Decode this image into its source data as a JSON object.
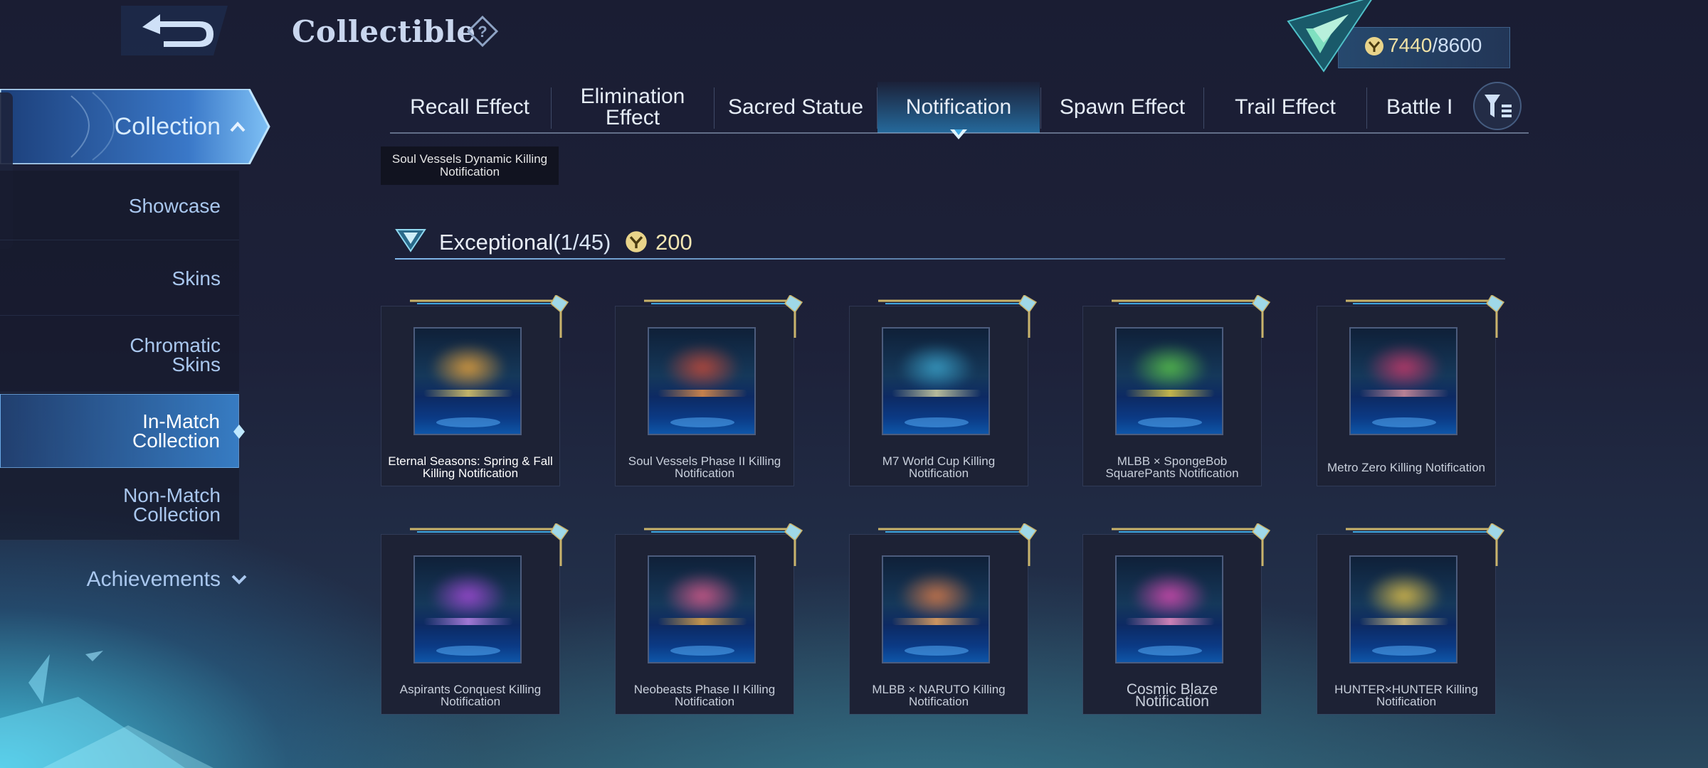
{
  "header": {
    "title": "Collectible",
    "points_current": "7440",
    "points_max": "/8600"
  },
  "sidebar": {
    "collection_label": "Collection",
    "items": [
      {
        "line1": "Showcase",
        "line2": ""
      },
      {
        "line1": "Skins",
        "line2": ""
      },
      {
        "line1": "Chromatic",
        "line2": "Skins"
      },
      {
        "line1": "In-Match",
        "line2": "Collection"
      },
      {
        "line1": "Non-Match",
        "line2": "Collection"
      }
    ],
    "achievements_label": "Achievements"
  },
  "tabs": [
    {
      "line1": "Recall Effect",
      "line2": ""
    },
    {
      "line1": "Elimination",
      "line2": "Effect"
    },
    {
      "line1": "Sacred Statue",
      "line2": ""
    },
    {
      "line1": "Notification",
      "line2": ""
    },
    {
      "line1": "Spawn Effect",
      "line2": ""
    },
    {
      "line1": "Trail Effect",
      "line2": ""
    },
    {
      "line1": "Battle I",
      "line2": ""
    }
  ],
  "tooltip": "Soul Vessels Dynamic Killing Notification",
  "section": {
    "title": "Exceptional",
    "count": "(1/45)",
    "points": "200"
  },
  "colors": {
    "accent": "#3fa7e0",
    "gold": "#f0e2a6",
    "active_tab": "#2f8fcf"
  },
  "cards": [
    {
      "name": "Eternal Seasons: Spring & Fall Killing Notification",
      "owned": true,
      "glow": "#e6a23c",
      "bar": "#d6c26a"
    },
    {
      "name": "Soul Vessels Phase II Killing Notification",
      "owned": false,
      "glow": "#c24a3a",
      "bar": "#d98a4a"
    },
    {
      "name": "M7 World Cup Killing Notification",
      "owned": false,
      "glow": "#3aa0c8",
      "bar": "#c9c9a0"
    },
    {
      "name": "MLBB × SpongeBob SquarePants Notification",
      "owned": false,
      "glow": "#58c24a",
      "bar": "#d6c24a"
    },
    {
      "name": "Metro Zero Killing Notification",
      "owned": false,
      "glow": "#c43a6a",
      "bar": "#c98a9a"
    },
    {
      "name": "Aspirants Conquest Killing Notification",
      "owned": false,
      "glow": "#a24ad6",
      "bar": "#b080e0"
    },
    {
      "name": "Neobeasts Phase II Killing Notification",
      "owned": false,
      "glow": "#d65a8a",
      "bar": "#d6a04a"
    },
    {
      "name": "MLBB × NARUTO Killing Notification",
      "owned": false,
      "glow": "#d67a4a",
      "bar": "#e0a060"
    },
    {
      "name": "Cosmic Blaze Notification",
      "owned": false,
      "glow": "#d64ab0",
      "bar": "#e08ac0"
    },
    {
      "name": "HUNTER×HUNTER Killing Notification",
      "owned": false,
      "glow": "#e0c04a",
      "bar": "#d6c080"
    }
  ]
}
